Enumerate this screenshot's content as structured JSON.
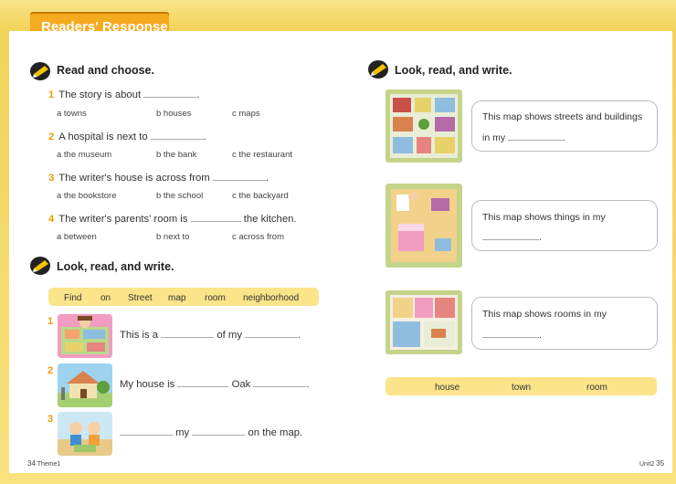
{
  "header": {
    "tab_label": "Readers' Response"
  },
  "left": {
    "section1_title": "Read and choose.",
    "questions": [
      {
        "num": "1",
        "stem_a": "The story is about",
        "stem_b": ".",
        "options": [
          "a  towns",
          "b  houses",
          "c  maps"
        ]
      },
      {
        "num": "2",
        "stem_a": "A hospital is next to",
        "stem_b": ".",
        "options": [
          "a  the museum",
          "b  the bank",
          "c  the restaurant"
        ]
      },
      {
        "num": "3",
        "stem_a": "The writer's house is across from",
        "stem_b": ".",
        "options": [
          "a  the bookstore",
          "b  the school",
          "c  the backyard"
        ]
      },
      {
        "num": "4",
        "stem_a": "The writer's parents' room is",
        "stem_b": "the kitchen.",
        "options": [
          "a  between",
          "b  next to",
          "c  across from"
        ]
      }
    ],
    "section2_title": "Look, read, and write.",
    "word_bank": [
      "Find",
      "on",
      "Street",
      "map",
      "room",
      "neighborhood"
    ],
    "exercises": [
      {
        "num": "1",
        "part_a": "This is a",
        "part_b": "of my",
        "part_c": "."
      },
      {
        "num": "2",
        "part_a": "My house is",
        "part_b": "Oak",
        "part_c": "."
      },
      {
        "num": "3",
        "part_a": "my",
        "part_b": "on the map."
      }
    ],
    "page_number": "34",
    "footer_label": "Theme1"
  },
  "right": {
    "section_title": "Look, read, and write.",
    "maps": [
      {
        "line1": "This map shows streets and buildings",
        "line2": "in my",
        "line2_end": "."
      },
      {
        "line1": "This map shows things in my",
        "line2_end": "."
      },
      {
        "line1": "This map shows rooms in my",
        "line2_end": "."
      }
    ],
    "word_bank": [
      "house",
      "town",
      "room"
    ],
    "page_number": "35",
    "footer_label": "Unit2"
  },
  "colors": {
    "accent_orange": "#f29a00",
    "tab_orange": "#f5ab1f",
    "word_bank_yellow": "#fbe48a",
    "map_green": "#c4d48a"
  }
}
